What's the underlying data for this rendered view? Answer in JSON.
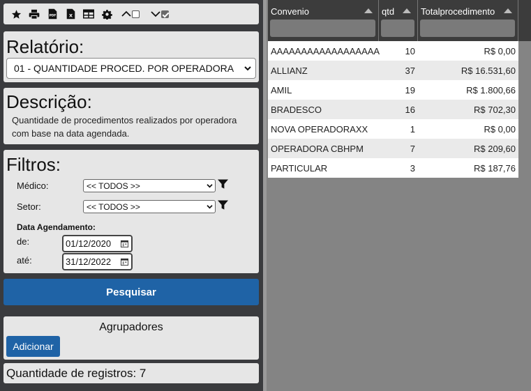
{
  "toolbar": {
    "icons": [
      "star-icon",
      "print-icon",
      "pdf-icon",
      "excel-icon",
      "table-icon",
      "gear-icon"
    ],
    "collapse_checked": false,
    "expand_checked": true
  },
  "relatorio": {
    "title": "Relatório:",
    "selected": "01 - QUANTIDADE PROCED. POR OPERADORA"
  },
  "descricao": {
    "title": "Descrição:",
    "text": "Quantidade de procedimentos realizados por operadora com base na data agendada."
  },
  "filtros": {
    "title": "Filtros:",
    "medico_label": "Médico:",
    "medico_value": "<< TODOS >>",
    "setor_label": "Setor:",
    "setor_value": "<< TODOS >>",
    "data_label": "Data Agendamento:",
    "de_label": "de:",
    "de_value": "01/12/2020",
    "ate_label": "até:",
    "ate_value": "31/12/2022"
  },
  "pesquisar_label": "Pesquisar",
  "agrupadores": {
    "title": "Agrupadores",
    "add_label": "Adicionar"
  },
  "quantidade": "Quantidade de registros: 7",
  "grid": {
    "columns": [
      "Convenio",
      "qtd",
      "Totalprocedimento"
    ],
    "rows": [
      {
        "convenio": "AAAAAAAAAAAAAAAAAA",
        "qtd": "10",
        "total": "R$ 0,00"
      },
      {
        "convenio": "ALLIANZ",
        "qtd": "37",
        "total": "R$ 16.531,60"
      },
      {
        "convenio": "AMIL",
        "qtd": "19",
        "total": "R$ 1.800,66"
      },
      {
        "convenio": "BRADESCO",
        "qtd": "16",
        "total": "R$ 702,30"
      },
      {
        "convenio": "NOVA OPERADORAXX",
        "qtd": "1",
        "total": "R$ 0,00"
      },
      {
        "convenio": "OPERADORA CBHPM",
        "qtd": "7",
        "total": "R$ 209,60"
      },
      {
        "convenio": "PARTICULAR",
        "qtd": "3",
        "total": "R$ 187,76"
      }
    ]
  },
  "colors": {
    "primary": "#1f63a6",
    "panel": "#e6e6e6",
    "background": "#3a3b3e",
    "grid_header": "#3c3c3c"
  }
}
